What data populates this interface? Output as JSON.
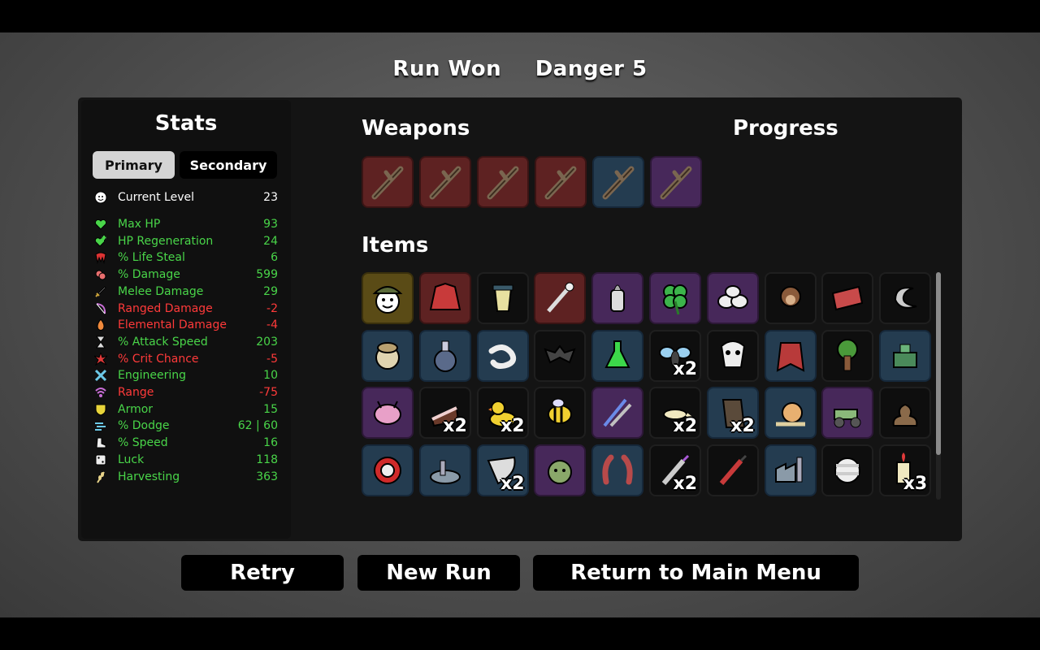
{
  "header": {
    "status": "Run Won",
    "danger": "Danger 5"
  },
  "stats": {
    "title": "Stats",
    "tabs": {
      "primary": "Primary",
      "secondary": "Secondary"
    },
    "current_level": {
      "label": "Current Level",
      "value": "23",
      "icon": "face-icon",
      "color": "#ffffff"
    },
    "rows": [
      {
        "label": "Max HP",
        "value": "93",
        "icon": "heart-icon",
        "color": "#49d549"
      },
      {
        "label": "HP Regeneration",
        "value": "24",
        "icon": "heart-plus-icon",
        "color": "#49d549"
      },
      {
        "label": "% Life Steal",
        "value": "6",
        "icon": "fangs-icon",
        "color": "#49d549"
      },
      {
        "label": "% Damage",
        "value": "599",
        "icon": "muscle-icon",
        "color": "#49d549"
      },
      {
        "label": "Melee Damage",
        "value": "29",
        "icon": "sword-icon",
        "color": "#49d549"
      },
      {
        "label": "Ranged Damage",
        "value": "-2",
        "icon": "bow-icon",
        "color": "#ff3a3a"
      },
      {
        "label": "Elemental Damage",
        "value": "-4",
        "icon": "flame-icon",
        "color": "#ff3a3a"
      },
      {
        "label": "% Attack Speed",
        "value": "203",
        "icon": "hourglass-icon",
        "color": "#49d549"
      },
      {
        "label": "% Crit Chance",
        "value": "-5",
        "icon": "burst-icon",
        "color": "#ff3a3a"
      },
      {
        "label": "Engineering",
        "value": "10",
        "icon": "wrench-icon",
        "color": "#49d549"
      },
      {
        "label": "Range",
        "value": "-75",
        "icon": "signal-icon",
        "color": "#ff3a3a"
      },
      {
        "label": "Armor",
        "value": "15",
        "icon": "shield-icon",
        "color": "#49d549"
      },
      {
        "label": "% Dodge",
        "value": "62 | 60",
        "icon": "wind-icon",
        "color": "#49d549"
      },
      {
        "label": "% Speed",
        "value": "16",
        "icon": "boot-icon",
        "color": "#49d549"
      },
      {
        "label": "Luck",
        "value": "118",
        "icon": "dice-icon",
        "color": "#49d549"
      },
      {
        "label": "Harvesting",
        "value": "363",
        "icon": "wheat-icon",
        "color": "#49d549"
      }
    ]
  },
  "weapons": {
    "title": "Weapons",
    "slots": [
      {
        "tier": "red",
        "icon": "stick-weapon-icon"
      },
      {
        "tier": "red",
        "icon": "stick-weapon-icon"
      },
      {
        "tier": "red",
        "icon": "stick-weapon-icon"
      },
      {
        "tier": "red",
        "icon": "stick-weapon-icon"
      },
      {
        "tier": "blue",
        "icon": "stick-weapon-icon"
      },
      {
        "tier": "purple",
        "icon": "stick-weapon-icon"
      }
    ]
  },
  "progress": {
    "title": "Progress"
  },
  "items": {
    "title": "Items",
    "rows": [
      [
        {
          "tier": "gold",
          "icon": "hat-character-icon",
          "qty": ""
        },
        {
          "tier": "red",
          "icon": "jacket-icon",
          "qty": ""
        },
        {
          "tier": "black",
          "icon": "juice-cup-icon",
          "qty": ""
        },
        {
          "tier": "red",
          "icon": "bone-wand-icon",
          "qty": ""
        },
        {
          "tier": "purple",
          "icon": "baby-bottle-icon",
          "qty": ""
        },
        {
          "tier": "purple",
          "icon": "clover-icon",
          "qty": ""
        },
        {
          "tier": "purple",
          "icon": "egg-cluster-icon",
          "qty": ""
        },
        {
          "tier": "black",
          "icon": "monkey-icon",
          "qty": ""
        },
        {
          "tier": "black",
          "icon": "ticket-icon",
          "qty": ""
        },
        {
          "tier": "black",
          "icon": "moon-swirl-icon",
          "qty": ""
        }
      ],
      [
        {
          "tier": "blue",
          "icon": "compass-icon",
          "qty": ""
        },
        {
          "tier": "blue",
          "icon": "potion-flask-icon",
          "qty": ""
        },
        {
          "tier": "blue",
          "icon": "worm-icon",
          "qty": ""
        },
        {
          "tier": "black",
          "icon": "bat-icon",
          "qty": ""
        },
        {
          "tier": "blue",
          "icon": "green-flask-icon",
          "qty": ""
        },
        {
          "tier": "black",
          "icon": "fly-icon",
          "qty": "x2"
        },
        {
          "tier": "black",
          "icon": "skull-mask-icon",
          "qty": ""
        },
        {
          "tier": "blue",
          "icon": "cape-icon",
          "qty": ""
        },
        {
          "tier": "black",
          "icon": "tree-icon",
          "qty": ""
        },
        {
          "tier": "blue",
          "icon": "turret-icon",
          "qty": ""
        }
      ],
      [
        {
          "tier": "purple",
          "icon": "brain-icon",
          "qty": ""
        },
        {
          "tier": "black",
          "icon": "cake-slice-icon",
          "qty": "x2"
        },
        {
          "tier": "black",
          "icon": "rubber-duck-icon",
          "qty": "x2"
        },
        {
          "tier": "black",
          "icon": "bee-icon",
          "qty": ""
        },
        {
          "tier": "purple",
          "icon": "magic-wands-icon",
          "qty": ""
        },
        {
          "tier": "black",
          "icon": "lizard-icon",
          "qty": "x2"
        },
        {
          "tier": "blue",
          "icon": "scroll-icon",
          "qty": "x2"
        },
        {
          "tier": "blue",
          "icon": "snail-icon",
          "qty": ""
        },
        {
          "tier": "purple",
          "icon": "tractor-icon",
          "qty": ""
        },
        {
          "tier": "black",
          "icon": "poop-icon",
          "qty": ""
        }
      ],
      [
        {
          "tier": "blue",
          "icon": "target-icon",
          "qty": ""
        },
        {
          "tier": "blue",
          "icon": "ruins-icon",
          "qty": ""
        },
        {
          "tier": "blue",
          "icon": "horn-icon",
          "qty": "x2"
        },
        {
          "tier": "purple",
          "icon": "zombie-icon",
          "qty": ""
        },
        {
          "tier": "blue",
          "icon": "claws-icon",
          "qty": ""
        },
        {
          "tier": "black",
          "icon": "syringe-icon",
          "qty": "x2"
        },
        {
          "tier": "black",
          "icon": "red-syringe-icon",
          "qty": ""
        },
        {
          "tier": "blue",
          "icon": "factory-icon",
          "qty": ""
        },
        {
          "tier": "black",
          "icon": "bandaged-face-icon",
          "qty": ""
        },
        {
          "tier": "black",
          "icon": "candle-icon",
          "qty": "x3"
        }
      ]
    ]
  },
  "buttons": {
    "retry": "Retry",
    "new_run": "New Run",
    "main_menu": "Return to Main Menu"
  }
}
